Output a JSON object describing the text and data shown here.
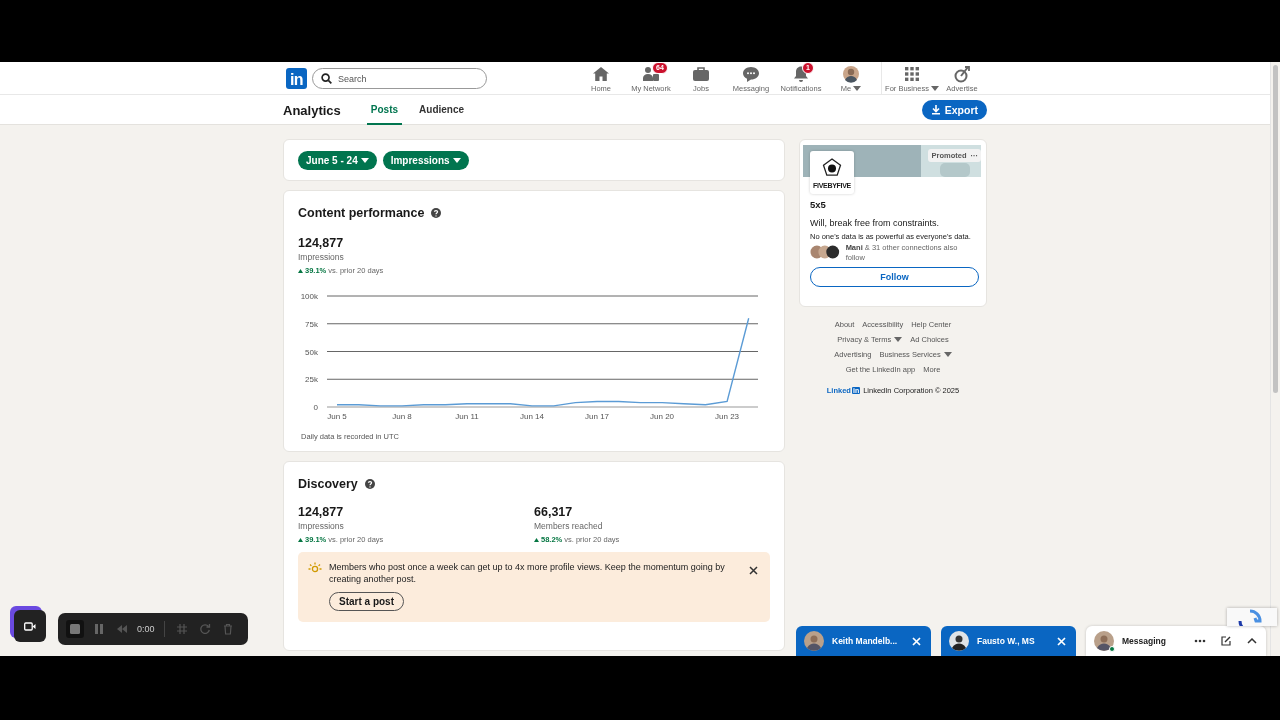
{
  "nav": {
    "logo": "in",
    "search": {
      "placeholder": "Search"
    },
    "items": [
      {
        "label": "Home",
        "dropdown": false
      },
      {
        "label": "My Network",
        "badge": "64",
        "dropdown": false
      },
      {
        "label": "Jobs",
        "dropdown": false
      },
      {
        "label": "Messaging",
        "dropdown": false
      },
      {
        "label": "Notifications",
        "badge": "1",
        "dropdown": false
      },
      {
        "label": "Me",
        "dropdown": true
      },
      {
        "label": "For Business",
        "dropdown": true
      },
      {
        "label": "Advertise",
        "dropdown": false
      }
    ]
  },
  "subnav": {
    "title": "Analytics",
    "tabs": [
      {
        "label": "Posts",
        "selected": true
      },
      {
        "label": "Audience",
        "selected": false
      }
    ],
    "export": "Export"
  },
  "filters": [
    {
      "label": "June 5 - 24",
      "dropdown": true
    },
    {
      "label": "Impressions",
      "dropdown": true
    }
  ],
  "content_performance": {
    "title": "Content performance",
    "value": "124,877",
    "label": "Impressions",
    "change": "39.1%",
    "change_text": "vs. prior 20 days",
    "chart_data": {
      "type": "line",
      "categories": [
        "Jun 5",
        null,
        null,
        "Jun 8",
        null,
        null,
        "Jun 11",
        null,
        null,
        "Jun 14",
        null,
        null,
        "Jun 17",
        null,
        null,
        "Jun 20",
        null,
        null,
        "Jun 23",
        null
      ],
      "values": [
        2000,
        2000,
        1000,
        1000,
        2000,
        2000,
        3000,
        3000,
        3000,
        1000,
        1000,
        4000,
        5000,
        5000,
        4000,
        4000,
        3000,
        2000,
        5000,
        80000
      ],
      "ylim": [
        0,
        100000
      ],
      "yticks": [
        {
          "value": 0,
          "label": "0"
        },
        {
          "value": 25000,
          "label": "25k"
        },
        {
          "value": 50000,
          "label": "50k"
        },
        {
          "value": 75000,
          "label": "75k"
        },
        {
          "value": 100000,
          "label": "100k"
        }
      ],
      "color": "#5b9bd5",
      "grid": true
    },
    "note": "Daily data is recorded in UTC"
  },
  "discovery": {
    "title": "Discovery",
    "metrics": [
      {
        "value": "124,877",
        "label": "Impressions",
        "change": "39.1%",
        "change_text": "vs. prior 20 days"
      },
      {
        "value": "66,317",
        "label": "Members reached",
        "change": "58.2%",
        "change_text": "vs. prior 20 days"
      }
    ],
    "tip": {
      "text": "Members who post once a week can get up to 4x more profile views. Keep the momentum going by creating another post.",
      "button": "Start a post"
    }
  },
  "ad": {
    "badge": "Promoted",
    "menu": "···",
    "logo_text": "FIVEBYFIVE",
    "name": "5x5",
    "headline": "Will, break free from constraints.",
    "body": "No one's data is as powerful as everyone's data.",
    "social": "**Mani** & 31 other connections also follow",
    "button": "Follow"
  },
  "footer": {
    "links": [
      {
        "label": "About",
        "dropdown": false
      },
      {
        "label": "Accessibility",
        "dropdown": false
      },
      {
        "label": "Help Center",
        "dropdown": false
      },
      {
        "label": "Privacy & Terms",
        "dropdown": true
      },
      {
        "label": "Ad Choices",
        "dropdown": false
      },
      {
        "label": "Advertising",
        "dropdown": false
      },
      {
        "label": "Business Services",
        "dropdown": true
      },
      {
        "label": "Get the LinkedIn app",
        "dropdown": false
      },
      {
        "label": "More",
        "dropdown": false
      }
    ],
    "brand": "Linked",
    "brand_box": "in",
    "copyright": "LinkedIn Corporation © 2025"
  },
  "recorder": {
    "time": "0:00"
  },
  "chats": [
    {
      "kind": "chat",
      "name": "Keith Mandelb..."
    },
    {
      "kind": "chat",
      "name": "Fausto W., MS"
    },
    {
      "kind": "messaging",
      "name": "Messaging",
      "online": true
    }
  ]
}
